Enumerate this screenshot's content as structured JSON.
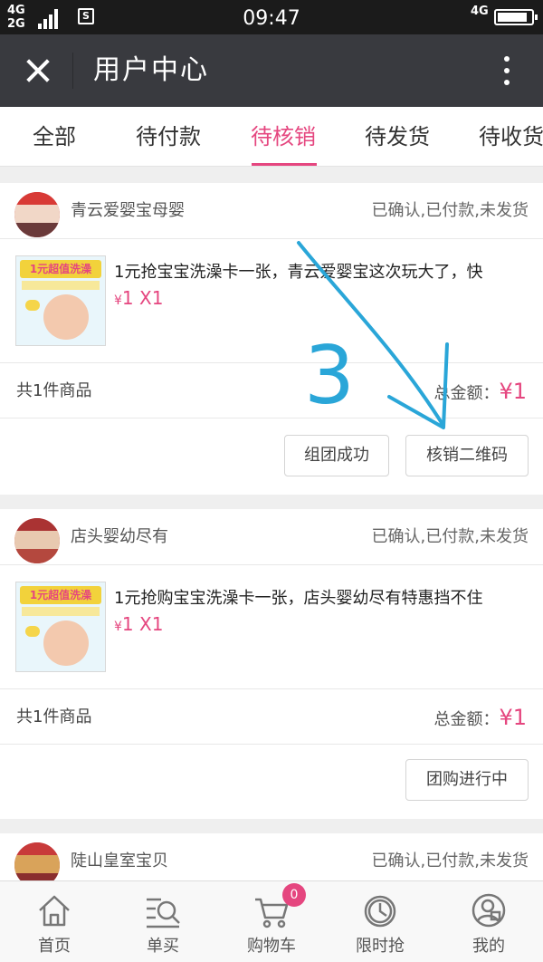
{
  "status_bar": {
    "network_top": "4G",
    "network_bottom": "2G",
    "sim_icon_label": "S",
    "time": "09:47",
    "network_right": "4G",
    "battery_level": 0.9
  },
  "titlebar": {
    "title": "用户中心",
    "close_icon": "close-icon",
    "more_icon": "more-vertical-icon"
  },
  "tabs": [
    {
      "label": "全部",
      "active": false
    },
    {
      "label": "待付款",
      "active": false
    },
    {
      "label": "待核销",
      "active": true
    },
    {
      "label": "待发货",
      "active": false
    },
    {
      "label": "待收货",
      "active": false
    }
  ],
  "orders": [
    {
      "store_name": "青云爱婴宝母婴",
      "status": "已确认,已付款,未发货",
      "item_title": "1元抢宝宝洗澡卡一张，青云爱婴宝这次玩大了，快",
      "item_thumb_text": "1元超值洗澡",
      "price_currency": "¥",
      "price": "1",
      "quantity": "X1",
      "count_text": "共1件商品",
      "total_label": "总金额：",
      "total_amount": "¥1",
      "buttons": [
        "组团成功",
        "核销二维码"
      ]
    },
    {
      "store_name": "店头婴幼尽有",
      "status": "已确认,已付款,未发货",
      "item_title": "1元抢购宝宝洗澡卡一张，店头婴幼尽有特惠挡不住",
      "item_thumb_text": "1元超值洗澡",
      "price_currency": "¥",
      "price": "1",
      "quantity": "X1",
      "count_text": "共1件商品",
      "total_label": "总金额：",
      "total_amount": "¥1",
      "buttons": [
        "团购进行中"
      ]
    },
    {
      "store_name": "陡山皇室宝贝",
      "status": "已确认,已付款,未发货"
    }
  ],
  "annotation": {
    "text": "3",
    "color": "#2aa6d8"
  },
  "bottom_nav": [
    {
      "label": "首页",
      "icon": "home-icon"
    },
    {
      "label": "单买",
      "icon": "search-list-icon"
    },
    {
      "label": "购物车",
      "icon": "cart-icon",
      "badge": "0"
    },
    {
      "label": "限时抢",
      "icon": "clock-icon"
    },
    {
      "label": "我的",
      "icon": "user-icon"
    }
  ],
  "colors": {
    "accent": "#e5467f",
    "titlebar": "#393a3f",
    "statusbar": "#1b1b1b"
  }
}
